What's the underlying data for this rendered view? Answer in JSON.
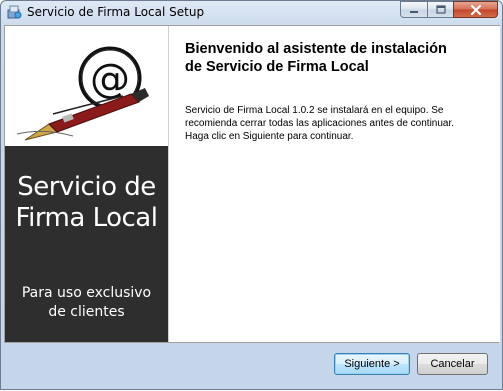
{
  "window": {
    "title": "Servicio de Firma Local Setup",
    "controls": {
      "minimize_icon": "minimize-icon",
      "maximize_icon": "maximize-icon",
      "close_icon": "close-icon"
    }
  },
  "sidebar": {
    "logo_icon": "at-sign-pen-logo",
    "title_line1": "Servicio de",
    "title_line2": "Firma Local",
    "subtitle_line1": "Para uso exclusivo",
    "subtitle_line2": "de clientes"
  },
  "main": {
    "heading_line1": "Bienvenido al asistente de instalación",
    "heading_line2": "de Servicio de Firma Local",
    "body_line1": "Servicio de Firma Local 1.0.2 se instalará en el equipo. Se",
    "body_line2": "recomienda cerrar todas las aplicaciones antes de continuar.",
    "body_line3": "Haga clic en Siguiente para continuar."
  },
  "footer": {
    "next_label": "Siguiente >",
    "cancel_label": "Cancelar"
  },
  "colors": {
    "sidebar_dark": "#2e2e2e",
    "accent_pen": "#8b1a1a"
  }
}
